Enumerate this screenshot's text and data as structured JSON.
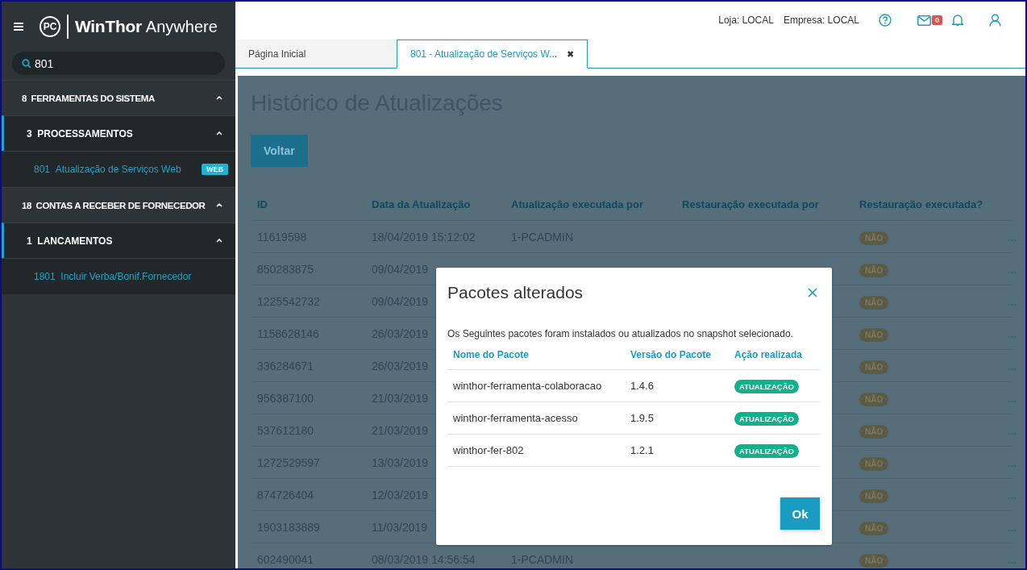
{
  "sidebar": {
    "logo": {
      "mark": "PC",
      "brand": "WinThor",
      "product": "Anywhere"
    },
    "search": {
      "value": "801"
    },
    "menu": [
      {
        "code": "8",
        "label": "FERRAMENTAS DO SISTEMA",
        "expanded": true,
        "children": [
          {
            "code": "3",
            "label": "PROCESSAMENTOS",
            "expanded": true,
            "children": [
              {
                "code": "801",
                "label": "Atualização de Serviços Web",
                "badge": "WEB"
              }
            ]
          }
        ]
      },
      {
        "code": "18",
        "label": "CONTAS A RECEBER DE FORNECEDOR",
        "expanded": true,
        "children": [
          {
            "code": "1",
            "label": "LANCAMENTOS",
            "expanded": true,
            "children": [
              {
                "code": "1801",
                "label": "Incluir Verba/Bonif.Fornecedor"
              }
            ]
          }
        ]
      }
    ]
  },
  "header": {
    "store": "Loja: LOCAL",
    "company": "Empresa: LOCAL",
    "mail_count": "0"
  },
  "tabs": [
    {
      "label": "Página Inicial",
      "selected": false
    },
    {
      "label": "801 - Atualização de Serviços W...",
      "selected": true,
      "close": "✖"
    }
  ],
  "page": {
    "title": "Histórico de Atualizações",
    "back_button": "Voltar",
    "table": {
      "columns": [
        "ID",
        "Data da Atualização",
        "Atualização executada por",
        "Restauração executada por",
        "Restauração executada?"
      ],
      "rows": [
        {
          "id": "11619598",
          "date": "18/04/2019 15:12:02",
          "updated_by": "1-PCADMIN",
          "restored": "NÃO"
        },
        {
          "id": "850283875",
          "date": "09/04/2019",
          "restored": "NÃO"
        },
        {
          "id": "1225542732",
          "date": "09/04/2019",
          "restored": "NÃO"
        },
        {
          "id": "1158628146",
          "date": "26/03/2019",
          "restored": "NÃO"
        },
        {
          "id": "336284671",
          "date": "26/03/2019",
          "restored": "NÃO"
        },
        {
          "id": "956387100",
          "date": "21/03/2019",
          "restored": "NÃO"
        },
        {
          "id": "537612180",
          "date": "21/03/2019",
          "restored": "NÃO"
        },
        {
          "id": "1272529597",
          "date": "13/03/2019",
          "restored": "NÃO"
        },
        {
          "id": "874726404",
          "date": "12/03/2019",
          "restored": "NÃO"
        },
        {
          "id": "1903183889",
          "date": "11/03/2019",
          "restored": "NÃO"
        },
        {
          "id": "602490041",
          "date": "08/03/2019 14:56:54",
          "updated_by": "1-PCADMIN",
          "restored": "NÃO"
        }
      ]
    }
  },
  "dialog": {
    "title": "Pacotes alterados",
    "message": "Os Seguintes pacotes foram instalados ou atualizados no snapshot selecionado.",
    "columns": [
      "Nome do Pacote",
      "Versão do Pacote",
      "Ação realizada"
    ],
    "rows": [
      {
        "name": "winthor-ferramenta-colaboracao",
        "version": "1.4.6",
        "action": "ATUALIZAÇÃO"
      },
      {
        "name": "winthor-ferramenta-acesso",
        "version": "1.9.5",
        "action": "ATUALIZAÇÃO"
      },
      {
        "name": "winthor-fer-802",
        "version": "1.2.1",
        "action": "ATUALIZAÇÃO"
      }
    ],
    "ok_button": "Ok"
  }
}
